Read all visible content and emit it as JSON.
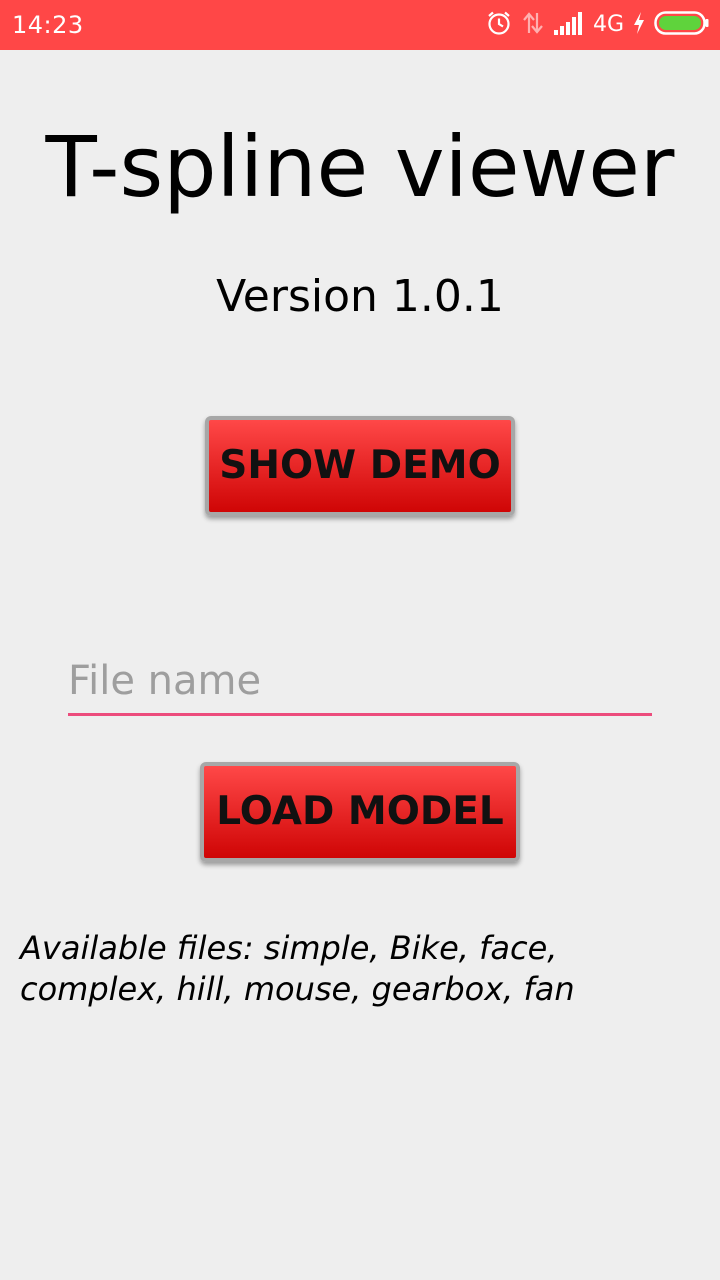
{
  "status_bar": {
    "time": "14:23",
    "network": "4G",
    "color": "#ff4747",
    "icons": [
      "alarm-icon",
      "data-transfer-icon",
      "signal-icon",
      "charging-icon",
      "battery-icon"
    ]
  },
  "main": {
    "title": "T-spline viewer",
    "version": "Version 1.0.1",
    "demo_button_label": "SHOW DEMO",
    "file_input": {
      "placeholder": "File name",
      "value": ""
    },
    "load_button_label": "LOAD MODEL",
    "files_text": "Available files: simple, Bike, face, complex, hill, mouse, gearbox, fan"
  },
  "colors": {
    "button_top": "#ff4848",
    "button_bottom": "#cf0505",
    "input_underline": "#ec4c7c",
    "background": "#eeeeee"
  }
}
